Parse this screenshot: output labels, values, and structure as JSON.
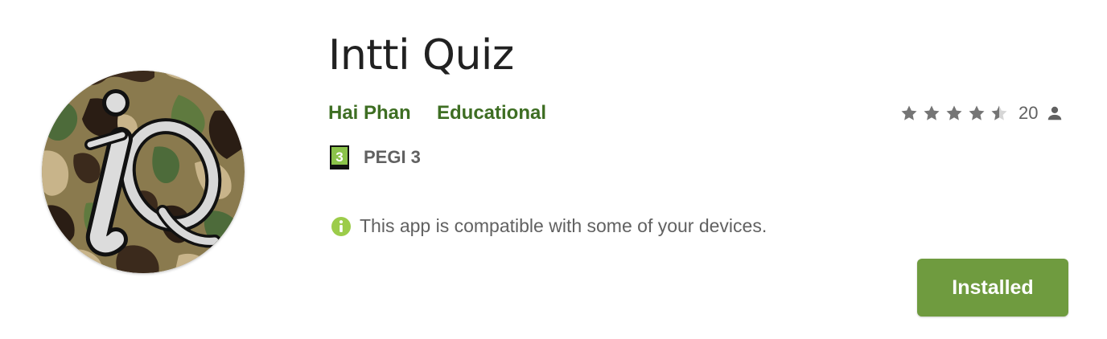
{
  "app": {
    "title": "Intti Quiz",
    "icon": "camo-iq-logo",
    "developer": "Hai Phan",
    "category": "Educational"
  },
  "rating": {
    "stars": 4.5,
    "max_stars": 5,
    "count": "20",
    "star_icon": "star-icon",
    "count_icon": "person-icon"
  },
  "content_rating": {
    "badge_value": "3",
    "label": "PEGI 3"
  },
  "compatibility": {
    "icon": "info-icon",
    "message": "This app is compatible with some of your devices."
  },
  "actions": {
    "install_label": "Installed"
  },
  "colors": {
    "link_green": "#3e6e23",
    "button_green": "#6f9b3f",
    "badge_green": "#8bc34a",
    "star_grey": "#757575",
    "text_grey": "#616161",
    "title": "#212121"
  }
}
